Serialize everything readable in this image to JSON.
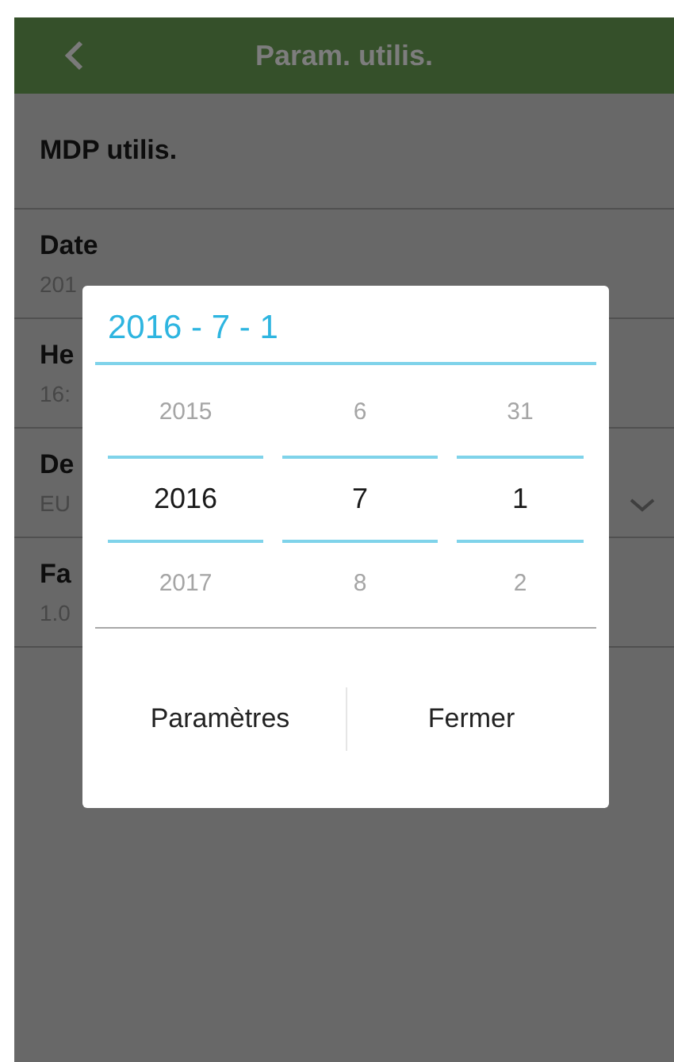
{
  "header": {
    "title": "Param. utilis."
  },
  "settings": [
    {
      "label": "MDP utilis.",
      "dropdown": false
    },
    {
      "label": "Date",
      "value": "201",
      "dropdown": false
    },
    {
      "label": "He",
      "value": "16:",
      "dropdown": false
    },
    {
      "label": "De",
      "value": "EU",
      "dropdown": true
    },
    {
      "label": "Fa",
      "value": "1.0",
      "dropdown": false
    }
  ],
  "dialog": {
    "title": "2016 - 7 - 1",
    "columns": [
      {
        "items": [
          {
            "text": "2015",
            "selected": false
          },
          {
            "text": "2016",
            "selected": true
          },
          {
            "text": "2017",
            "selected": false
          }
        ]
      },
      {
        "items": [
          {
            "text": "6",
            "selected": false
          },
          {
            "text": "7",
            "selected": true
          },
          {
            "text": "8",
            "selected": false
          }
        ]
      },
      {
        "items": [
          {
            "text": "31",
            "selected": false
          },
          {
            "text": "1",
            "selected": true
          },
          {
            "text": "2",
            "selected": false
          }
        ]
      }
    ],
    "buttons": [
      "Paramètres",
      "Fermer"
    ]
  }
}
